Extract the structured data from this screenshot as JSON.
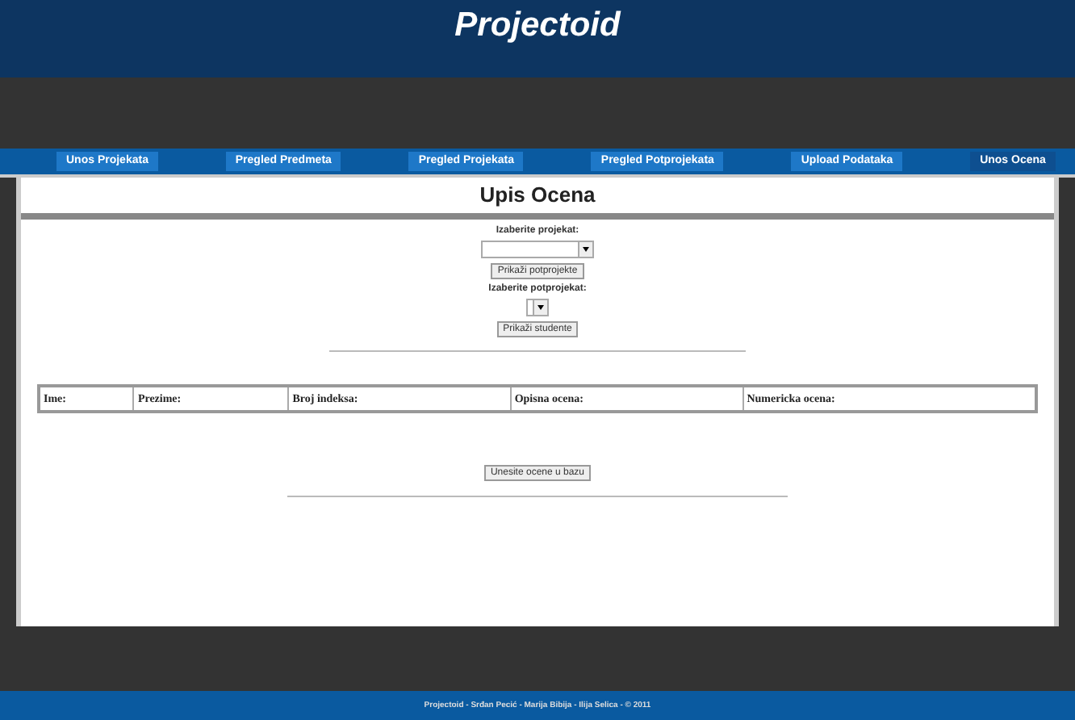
{
  "header": {
    "title": "Projectoid"
  },
  "nav": [
    {
      "label": "Unos Projekata",
      "selected": false
    },
    {
      "label": "Pregled Predmeta",
      "selected": false
    },
    {
      "label": "Pregled Projekata",
      "selected": false
    },
    {
      "label": "Pregled Potprojekata",
      "selected": false
    },
    {
      "label": "Upload Podataka",
      "selected": false
    },
    {
      "label": "Unos Ocena",
      "selected": true
    }
  ],
  "page_title": "Upis Ocena",
  "form": {
    "project_label": "Izaberite projekat:",
    "show_subprojects": "Prikaži potprojekte",
    "subproject_label": "Izaberite potprojekat:",
    "show_students": "Prikaži studente"
  },
  "table": {
    "columns": [
      "Ime:",
      "Prezime:",
      "Broj indeksa:",
      "Opisna ocena:",
      "Numericka ocena:"
    ]
  },
  "submit": "Unesite ocene u bazu",
  "footer": "Projectoid - Srđan Pecić - Marija Bibija - Ilija Selica - © 2011"
}
